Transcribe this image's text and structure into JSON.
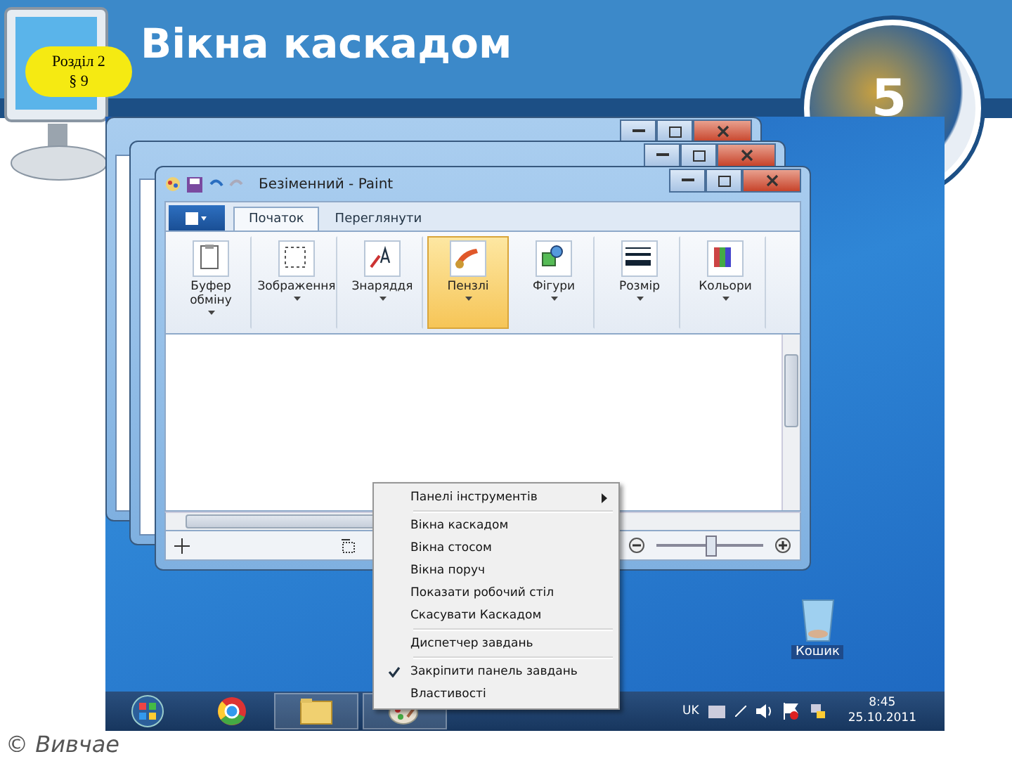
{
  "slide": {
    "section_badge": {
      "section": "Розділ 2",
      "paragraph": "§ 9"
    },
    "title": "Вікна каскадом",
    "logo_number": "5",
    "footer": "© Вивчае"
  },
  "desktop": {
    "paint_window": {
      "title": "Безіменний - Paint",
      "tabs": [
        {
          "label": "Початок",
          "selected": true
        },
        {
          "label": "Переглянути",
          "selected": false
        }
      ],
      "ribbon_groups": [
        {
          "label": "Буфер обміну",
          "selected": false
        },
        {
          "label": "Зображення",
          "selected": false
        },
        {
          "label": "Знаряддя",
          "selected": false
        },
        {
          "label": "Пензлі",
          "selected": true
        },
        {
          "label": "Фігури",
          "selected": false
        },
        {
          "label": "Розмір",
          "selected": false
        },
        {
          "label": "Кольори",
          "selected": false
        }
      ],
      "zoom_slider": {
        "level": 0.5
      }
    },
    "context_menu": {
      "items": [
        {
          "kind": "submenu",
          "label": "Панелі інструментів",
          "checked": false
        },
        {
          "kind": "separator"
        },
        {
          "kind": "item",
          "label": "Вікна каскадом",
          "checked": false
        },
        {
          "kind": "item",
          "label": "Вікна стосом",
          "checked": false
        },
        {
          "kind": "item",
          "label": "Вікна поруч",
          "checked": false
        },
        {
          "kind": "item",
          "label": "Показати робочий стіл",
          "checked": false
        },
        {
          "kind": "item",
          "label": "Скасувати Каскадом",
          "checked": false
        },
        {
          "kind": "separator"
        },
        {
          "kind": "item",
          "label": "Диспетчер завдань",
          "checked": false
        },
        {
          "kind": "separator"
        },
        {
          "kind": "item",
          "label": "Закріпити панель завдань",
          "checked": true
        },
        {
          "kind": "item",
          "label": "Властивості",
          "checked": false
        }
      ]
    },
    "recycle_bin": {
      "label": "Кошик"
    },
    "taskbar": {
      "language": "UK",
      "time": "8:45",
      "date": "25.10.2011"
    }
  }
}
